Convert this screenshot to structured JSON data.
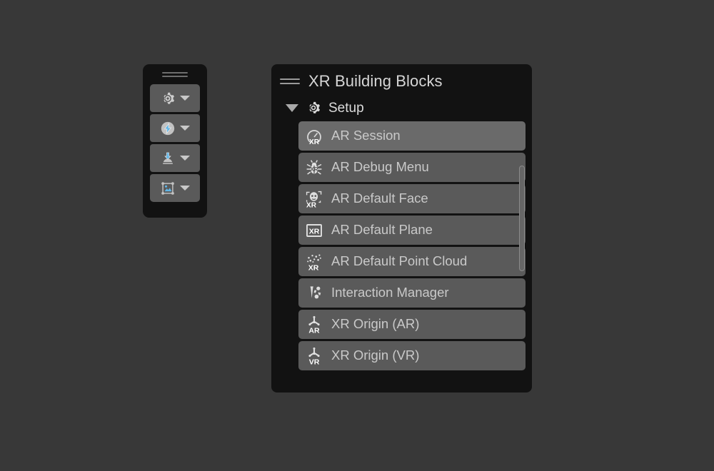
{
  "window": {
    "background_color": "#383838"
  },
  "toolbar": {
    "name": "Overlay Toolbar",
    "drag_handle": "drag-handle",
    "background_color": "#121212",
    "button_color": "#5a5a5a",
    "buttons": [
      {
        "icon": "gear-icon",
        "label": "",
        "has_dropdown": true,
        "accent": "#cccccc"
      },
      {
        "icon": "lightning-bolt-circle-icon",
        "label": "",
        "has_dropdown": true,
        "accent": "#6ec6f0"
      },
      {
        "icon": "import-download-icon",
        "label": "",
        "has_dropdown": true,
        "accent": "#6ec6f0"
      },
      {
        "icon": "sprite-image-icon",
        "label": "",
        "has_dropdown": true,
        "accent": "#6ec6f0"
      }
    ]
  },
  "panel": {
    "menu_icon": "hamburger-menu-icon",
    "title": "XR Building Blocks",
    "background_color": "#121212",
    "title_color": "#d6d6d6",
    "section": {
      "expanded": true,
      "disclosure_icon": "triangle-down-icon",
      "icon": "gear-icon",
      "title": "Setup"
    },
    "items": [
      {
        "icon": "ar-session-icon",
        "label": "AR Session",
        "hovered": true
      },
      {
        "icon": "ar-debug-menu-icon",
        "label": "AR Debug Menu",
        "hovered": false
      },
      {
        "icon": "ar-default-face-icon",
        "label": "AR Default Face",
        "hovered": false
      },
      {
        "icon": "ar-default-plane-icon",
        "label": "AR Default Plane",
        "hovered": false
      },
      {
        "icon": "ar-default-point-cloud-icon",
        "label": "AR Default Point Cloud",
        "hovered": false
      },
      {
        "icon": "interaction-manager-icon",
        "label": "Interaction Manager",
        "hovered": false
      },
      {
        "icon": "xr-origin-ar-icon",
        "label": "XR Origin (AR)",
        "hovered": false
      },
      {
        "icon": "xr-origin-vr-icon",
        "label": "XR Origin (VR)",
        "hovered": false
      }
    ],
    "scrollbar": {
      "name": "vertical-scrollbar",
      "thumb_color": "#666666"
    }
  }
}
